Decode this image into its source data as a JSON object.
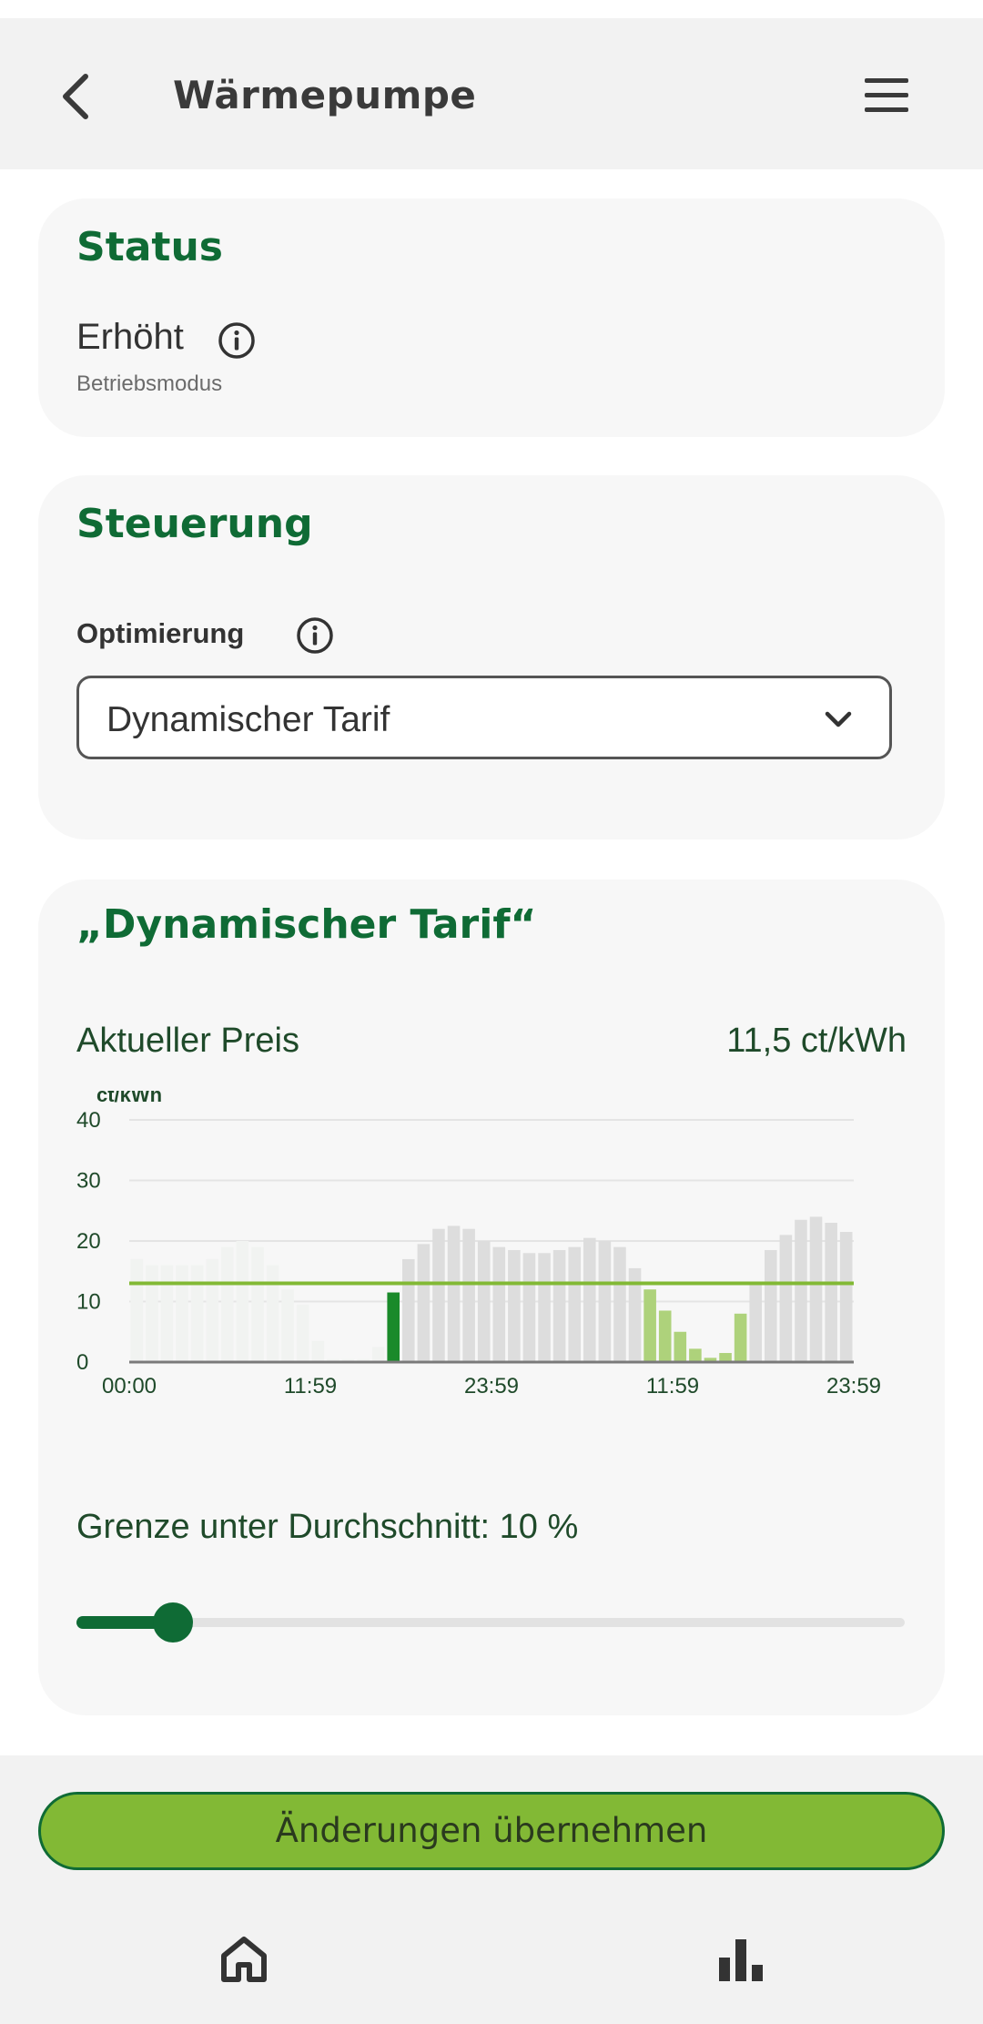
{
  "app_bar": {
    "title": "Wärmepumpe",
    "back_icon": "chevron-left-icon",
    "menu_icon": "hamburger-icon"
  },
  "status": {
    "heading": "Status",
    "value": "Erhöht",
    "sub_label": "Betriebsmodus",
    "info_icon": "info-icon"
  },
  "steuerung": {
    "heading": "Steuerung",
    "optimization_label": "Optimierung",
    "selected_option": "Dynamischer Tarif",
    "dropdown_icon": "chevron-down-icon"
  },
  "tarif": {
    "heading": "„Dynamischer Tarif“",
    "current_price_label": "Aktueller Preis",
    "current_price_value": "11,5 ct/kWh",
    "limit_label": "Grenze unter Durchschnitt: 10 %",
    "limit_percent": 10
  },
  "chart_data": {
    "type": "bar",
    "ylabel": "ct/kWh",
    "ylim": [
      0,
      40
    ],
    "y_ticks": [
      0,
      10,
      20,
      30,
      40
    ],
    "x_tick_labels": [
      "00:00",
      "11:59",
      "23:59",
      "11:59",
      "23:59"
    ],
    "x_tick_index": [
      0,
      12,
      24,
      36,
      48
    ],
    "reference_line": 13,
    "colors": {
      "past": "#f1f3f1",
      "future": "#dddddd",
      "current": "#1a8a2a",
      "cheap": "#aed27b",
      "reference_line": "#82b935",
      "axis_text": "#1f4a2a"
    },
    "bars": [
      {
        "v": 17,
        "s": "past"
      },
      {
        "v": 16,
        "s": "past"
      },
      {
        "v": 16,
        "s": "past"
      },
      {
        "v": 16,
        "s": "past"
      },
      {
        "v": 16,
        "s": "past"
      },
      {
        "v": 17,
        "s": "past"
      },
      {
        "v": 19,
        "s": "past"
      },
      {
        "v": 20,
        "s": "past"
      },
      {
        "v": 19,
        "s": "past"
      },
      {
        "v": 16,
        "s": "past"
      },
      {
        "v": 12,
        "s": "past"
      },
      {
        "v": 9.5,
        "s": "past"
      },
      {
        "v": 3.5,
        "s": "past"
      },
      {
        "v": 0.5,
        "s": "past"
      },
      {
        "v": 0.5,
        "s": "past"
      },
      {
        "v": 0.5,
        "s": "past"
      },
      {
        "v": 2.5,
        "s": "past"
      },
      {
        "v": 11.5,
        "s": "current"
      },
      {
        "v": 17,
        "s": "future"
      },
      {
        "v": 19.5,
        "s": "future"
      },
      {
        "v": 22,
        "s": "future"
      },
      {
        "v": 22.5,
        "s": "future"
      },
      {
        "v": 22,
        "s": "future"
      },
      {
        "v": 20,
        "s": "future"
      },
      {
        "v": 19,
        "s": "future"
      },
      {
        "v": 18.5,
        "s": "future"
      },
      {
        "v": 18,
        "s": "future"
      },
      {
        "v": 18,
        "s": "future"
      },
      {
        "v": 18.5,
        "s": "future"
      },
      {
        "v": 19,
        "s": "future"
      },
      {
        "v": 20.5,
        "s": "future"
      },
      {
        "v": 20,
        "s": "future"
      },
      {
        "v": 19,
        "s": "future"
      },
      {
        "v": 15.5,
        "s": "future"
      },
      {
        "v": 12,
        "s": "cheap"
      },
      {
        "v": 8.5,
        "s": "cheap"
      },
      {
        "v": 5,
        "s": "cheap"
      },
      {
        "v": 2.2,
        "s": "cheap"
      },
      {
        "v": 0.7,
        "s": "cheap"
      },
      {
        "v": 1.5,
        "s": "cheap"
      },
      {
        "v": 8,
        "s": "cheap"
      },
      {
        "v": 13,
        "s": "future"
      },
      {
        "v": 18.5,
        "s": "future"
      },
      {
        "v": 21,
        "s": "future"
      },
      {
        "v": 23.5,
        "s": "future"
      },
      {
        "v": 24,
        "s": "future"
      },
      {
        "v": 23,
        "s": "future"
      },
      {
        "v": 21.5,
        "s": "future"
      }
    ]
  },
  "footer": {
    "apply_label": "Änderungen übernehmen",
    "home_icon": "home-icon",
    "stats_icon": "bar-chart-icon"
  }
}
